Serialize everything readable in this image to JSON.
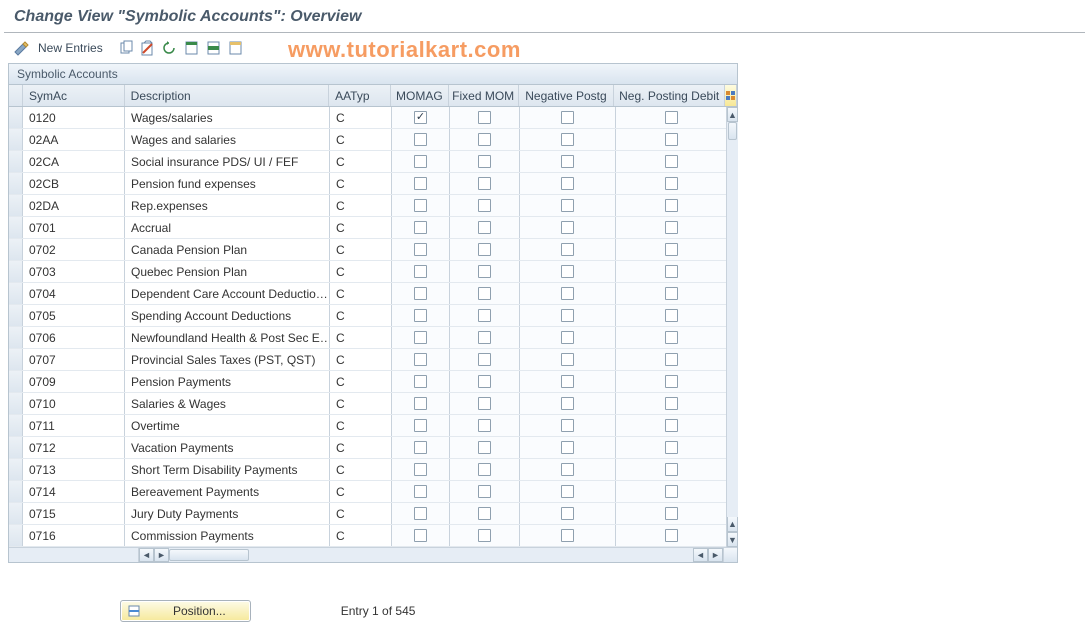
{
  "page": {
    "title": "Change View \"Symbolic Accounts\": Overview"
  },
  "watermark": "www.tutorialkart.com",
  "toolbar": {
    "new_entries": "New Entries"
  },
  "panel": {
    "title": "Symbolic Accounts"
  },
  "columns": {
    "symac": "SymAc",
    "description": "Description",
    "aatyp": "AATyp",
    "momag": "MOMAG",
    "fixed_mom": "Fixed MOM",
    "neg_postg": "Negative Postg",
    "neg_posting_debit": "Neg. Posting Debit"
  },
  "rows": [
    {
      "symac": "0120",
      "description": "Wages/salaries",
      "aatyp": "C",
      "momag": true,
      "fixed": false,
      "neg": false,
      "negd": false
    },
    {
      "symac": "02AA",
      "description": "Wages and salaries",
      "aatyp": "C",
      "momag": false,
      "fixed": false,
      "neg": false,
      "negd": false
    },
    {
      "symac": "02CA",
      "description": "Social insurance PDS/ UI / FEF",
      "aatyp": "C",
      "momag": false,
      "fixed": false,
      "neg": false,
      "negd": false
    },
    {
      "symac": "02CB",
      "description": "Pension fund expenses",
      "aatyp": "C",
      "momag": false,
      "fixed": false,
      "neg": false,
      "negd": false
    },
    {
      "symac": "02DA",
      "description": "Rep.expenses",
      "aatyp": "C",
      "momag": false,
      "fixed": false,
      "neg": false,
      "negd": false
    },
    {
      "symac": "0701",
      "description": "Accrual",
      "aatyp": "C",
      "momag": false,
      "fixed": false,
      "neg": false,
      "negd": false
    },
    {
      "symac": "0702",
      "description": "Canada Pension Plan",
      "aatyp": "C",
      "momag": false,
      "fixed": false,
      "neg": false,
      "negd": false
    },
    {
      "symac": "0703",
      "description": "Quebec Pension Plan",
      "aatyp": "C",
      "momag": false,
      "fixed": false,
      "neg": false,
      "negd": false
    },
    {
      "symac": "0704",
      "description": "Dependent Care Account Deductio…",
      "aatyp": "C",
      "momag": false,
      "fixed": false,
      "neg": false,
      "negd": false
    },
    {
      "symac": "0705",
      "description": "Spending Account Deductions",
      "aatyp": "C",
      "momag": false,
      "fixed": false,
      "neg": false,
      "negd": false
    },
    {
      "symac": "0706",
      "description": "Newfoundland Health & Post Sec E…",
      "aatyp": "C",
      "momag": false,
      "fixed": false,
      "neg": false,
      "negd": false
    },
    {
      "symac": "0707",
      "description": "Provincial Sales Taxes (PST, QST)",
      "aatyp": "C",
      "momag": false,
      "fixed": false,
      "neg": false,
      "negd": false
    },
    {
      "symac": "0709",
      "description": "Pension Payments",
      "aatyp": "C",
      "momag": false,
      "fixed": false,
      "neg": false,
      "negd": false
    },
    {
      "symac": "0710",
      "description": "Salaries & Wages",
      "aatyp": "C",
      "momag": false,
      "fixed": false,
      "neg": false,
      "negd": false
    },
    {
      "symac": "0711",
      "description": "Overtime",
      "aatyp": "C",
      "momag": false,
      "fixed": false,
      "neg": false,
      "negd": false
    },
    {
      "symac": "0712",
      "description": "Vacation Payments",
      "aatyp": "C",
      "momag": false,
      "fixed": false,
      "neg": false,
      "negd": false
    },
    {
      "symac": "0713",
      "description": "Short Term Disability Payments",
      "aatyp": "C",
      "momag": false,
      "fixed": false,
      "neg": false,
      "negd": false
    },
    {
      "symac": "0714",
      "description": "Bereavement Payments",
      "aatyp": "C",
      "momag": false,
      "fixed": false,
      "neg": false,
      "negd": false
    },
    {
      "symac": "0715",
      "description": "Jury Duty Payments",
      "aatyp": "C",
      "momag": false,
      "fixed": false,
      "neg": false,
      "negd": false
    },
    {
      "symac": "0716",
      "description": "Commission Payments",
      "aatyp": "C",
      "momag": false,
      "fixed": false,
      "neg": false,
      "negd": false
    }
  ],
  "footer": {
    "position_label": "Position...",
    "entry_text": "Entry 1 of 545"
  },
  "icons": {
    "toggle": "toggle-icon",
    "copy": "copy-icon",
    "delete": "delete-icon",
    "undo": "undo-icon",
    "select_all": "select-all-icon",
    "select_block": "select-block-icon",
    "deselect": "deselect-icon",
    "config": "table-settings-icon",
    "position": "position-icon"
  }
}
